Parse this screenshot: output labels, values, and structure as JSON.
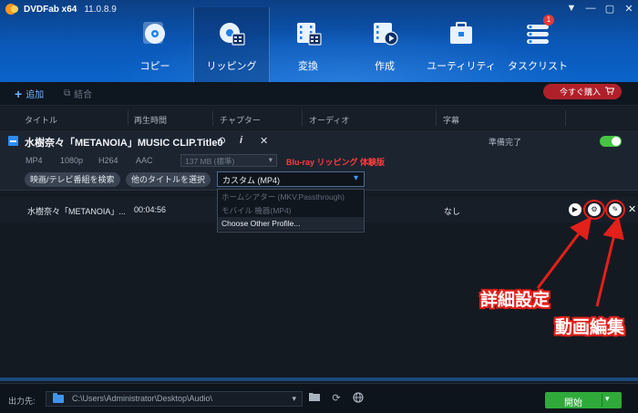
{
  "app": {
    "name": "DVDFab x64",
    "version": "11.0.8.9",
    "window_controls": [
      "▼",
      "—",
      "▢",
      "✕"
    ]
  },
  "nav": {
    "items": [
      {
        "label": "コピー",
        "icon": "copy-disc-icon"
      },
      {
        "label": "リッピング",
        "icon": "ripper-disc-icon",
        "active": true
      },
      {
        "label": "変換",
        "icon": "converter-film-icon"
      },
      {
        "label": "作成",
        "icon": "creator-play-icon"
      },
      {
        "label": "ユーティリティ",
        "icon": "utility-briefcase-icon"
      },
      {
        "label": "タスクリスト",
        "icon": "task-list-icon",
        "badge": "1"
      }
    ]
  },
  "toolbar": {
    "add_label": "追加",
    "merge_label": "結合",
    "buy_label": "今すぐ購入"
  },
  "columns": [
    "タイトル",
    "再生時間",
    "チャプター",
    "オーディオ",
    "字幕"
  ],
  "source": {
    "title": "水樹奈々「METANOIA」MUSIC CLIP.Title0",
    "status": "準備完了",
    "format": "MP4",
    "resolution": "1080p",
    "video_codec": "H264",
    "audio_codec": "AAC",
    "size": "137 MB (標準)",
    "note": "Blu-ray リッピング 体験版",
    "buttons": {
      "search_movie": "映画/テレビ番組を検索",
      "select_other": "他のタイトルを選択"
    },
    "profile": "カスタム (MP4)",
    "profile_options": [
      "ホームシアター (MKV.Passthrough)",
      "モバイル 機器(MP4)",
      "Choose Other Profile..."
    ]
  },
  "track": {
    "title": "水樹奈々「METANOIA」...",
    "duration": "00:04:56",
    "subtitle": "なし"
  },
  "annotations": {
    "settings": "詳細設定",
    "edit": "動画編集"
  },
  "footer": {
    "output_label": "出力先:",
    "path": "C:\\Users\\Administrator\\Desktop\\Audio\\",
    "start_label": "開始"
  },
  "colors": {
    "accent": "#2d8cf0",
    "start": "#2faa3a",
    "buy": "#b0202a",
    "annotation": "#e3201a"
  }
}
